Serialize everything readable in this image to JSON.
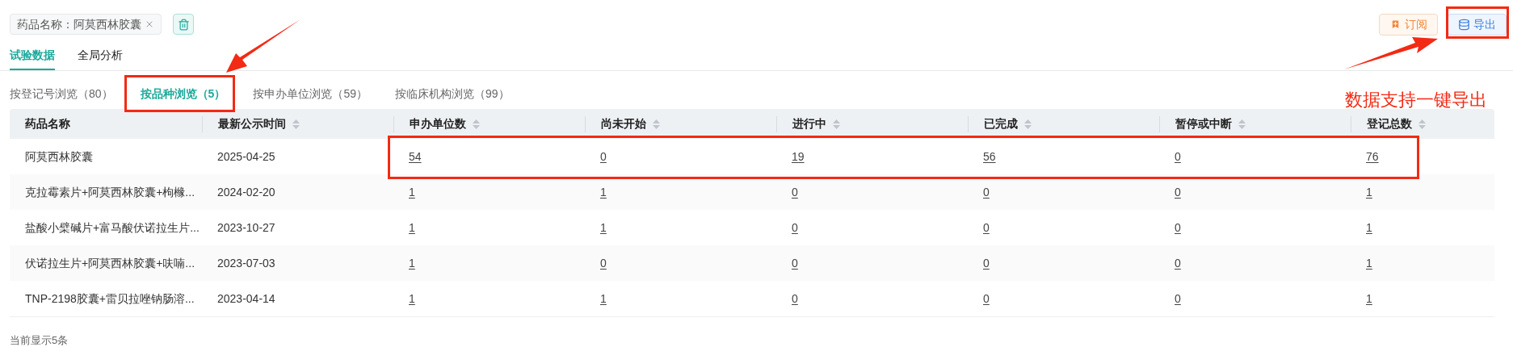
{
  "filter_chip": {
    "label": "药品名称：",
    "value": "阿莫西林胶囊"
  },
  "actions": [
    {
      "kind": "subscribe",
      "label": "订阅"
    },
    {
      "kind": "export",
      "label": "导出"
    }
  ],
  "tabs": [
    {
      "label": "试验数据",
      "selected": true
    },
    {
      "label": "全局分析",
      "selected": false
    }
  ],
  "sub_tabs": [
    {
      "label": "按登记号浏览（80）",
      "selected": false
    },
    {
      "label": "按品种浏览（5）",
      "selected": true
    },
    {
      "label": "按申办单位浏览（59）",
      "selected": false
    },
    {
      "label": "按临床机构浏览（99）",
      "selected": false
    }
  ],
  "table": {
    "columns": [
      {
        "label": "药品名称",
        "sortable": false
      },
      {
        "label": "最新公示时间",
        "sortable": true
      },
      {
        "label": "申办单位数",
        "sortable": true
      },
      {
        "label": "尚未开始",
        "sortable": true
      },
      {
        "label": "进行中",
        "sortable": true
      },
      {
        "label": "已完成",
        "sortable": true
      },
      {
        "label": "暂停或中断",
        "sortable": true
      },
      {
        "label": "登记总数",
        "sortable": true
      }
    ],
    "rows": [
      [
        "阿莫西林胶囊",
        "2025-04-25",
        "54",
        "0",
        "19",
        "56",
        "0",
        "76"
      ],
      [
        "克拉霉素片+阿莫西林胶囊+枸橼...",
        "2024-02-20",
        "1",
        "1",
        "0",
        "0",
        "0",
        "1"
      ],
      [
        "盐酸小檗碱片+富马酸伏诺拉生片...",
        "2023-10-27",
        "1",
        "1",
        "0",
        "0",
        "0",
        "1"
      ],
      [
        "伏诺拉生片+阿莫西林胶囊+呋喃...",
        "2023-07-03",
        "1",
        "0",
        "0",
        "0",
        "0",
        "1"
      ],
      [
        "TNP-2198胶囊+雷贝拉唑钠肠溶...",
        "2023-04-14",
        "1",
        "1",
        "0",
        "0",
        "0",
        "1"
      ]
    ]
  },
  "footer": "当前显示5条",
  "annotation": {
    "callout": "数据支持一键导出"
  }
}
